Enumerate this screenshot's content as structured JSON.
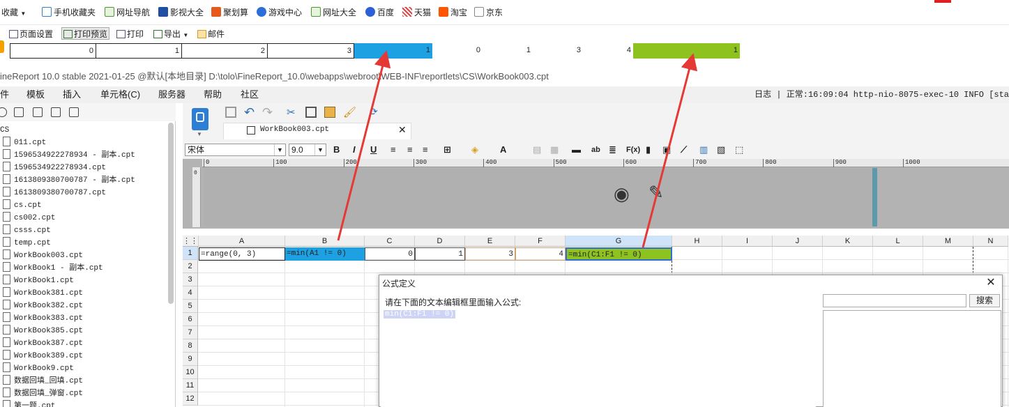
{
  "bookmarks": {
    "items": [
      {
        "label": "收藏",
        "icon": "star-icon"
      },
      {
        "label": "手机收藏夹",
        "icon": "phone-icon"
      },
      {
        "label": "网址导航",
        "icon": "nav-icon"
      },
      {
        "label": "影视大全",
        "icon": "video-icon"
      },
      {
        "label": "聚划算",
        "icon": "deal-icon"
      },
      {
        "label": "游戏中心",
        "icon": "game-icon"
      },
      {
        "label": "网址大全",
        "icon": "sites-icon"
      },
      {
        "label": "百度",
        "icon": "baidu-icon"
      },
      {
        "label": "天猫",
        "icon": "tmall-icon"
      },
      {
        "label": "淘宝",
        "icon": "taobao-icon"
      },
      {
        "label": "京东",
        "icon": "jd-icon"
      }
    ]
  },
  "printbar": {
    "page_setup": "页面设置",
    "print_preview": "打印预览",
    "print": "打印",
    "export": "导出",
    "mail": "邮件"
  },
  "preview": {
    "cells": [
      "0",
      "1",
      "2",
      "3",
      "1",
      "0",
      "1",
      "3",
      "4",
      "1"
    ]
  },
  "titlebar": {
    "text": "ineReport 10.0 stable 2021-01-25 @默认[本地目录]    D:\\tolo\\FineReport_10.0\\webapps\\webroot\\WEB-INF\\reportlets\\CS\\WorkBook003.cpt"
  },
  "menubar": {
    "items": [
      "件",
      "模板",
      "插入",
      "单元格(C)",
      "服务器",
      "帮助",
      "社区"
    ],
    "log": "日志 | 正常:16:09:04 http-nio-8075-exec-10 INFO [sta"
  },
  "filetree": {
    "root": "CS",
    "files": [
      "011.cpt",
      "1596534922278934 - 副本.cpt",
      "1596534922278934.cpt",
      "1613809380700787 - 副本.cpt",
      "1613809380700787.cpt",
      "cs.cpt",
      "cs002.cpt",
      "csss.cpt",
      "temp.cpt",
      "WorkBook003.cpt",
      "WorkBook1 - 副本.cpt",
      "WorkBook1.cpt",
      "WorkBook381.cpt",
      "WorkBook382.cpt",
      "WorkBook383.cpt",
      "WorkBook385.cpt",
      "WorkBook387.cpt",
      "WorkBook389.cpt",
      "WorkBook9.cpt",
      "数据回填_回填.cpt",
      "数据回填_弹窗.cpt",
      "第一题.cpt"
    ]
  },
  "editor": {
    "tab_name": "WorkBook003.cpt",
    "font_name": "宋体",
    "font_size": "9.0",
    "ruler_ticks": [
      "0",
      "100",
      "200",
      "300",
      "400",
      "500",
      "600",
      "700",
      "800",
      "900",
      "1000"
    ],
    "vruler_label": "0"
  },
  "grid": {
    "columns": [
      "A",
      "B",
      "C",
      "D",
      "E",
      "F",
      "G",
      "H",
      "I",
      "J",
      "K",
      "L",
      "M",
      "N"
    ],
    "rows": [
      "1",
      "2",
      "3",
      "4",
      "5",
      "6",
      "7",
      "8",
      "9",
      "10",
      "11",
      "12"
    ],
    "row1": {
      "A": "=range(0, 3)",
      "B": "=min(A1 != 0)",
      "C": "0",
      "D": "1",
      "E": "3",
      "F": "4",
      "G": "=min(C1:F1 != 0)"
    }
  },
  "dialog": {
    "title": "公式定义",
    "prompt": "请在下面的文本编辑框里面输入公式:",
    "formula": "min(C1:F1 != 0)",
    "search_button": "搜索",
    "search_placeholder": ""
  },
  "colors": {
    "blue_highlight": "#1da1e2",
    "green_highlight": "#8dc21f",
    "arrow": "#e53935"
  }
}
